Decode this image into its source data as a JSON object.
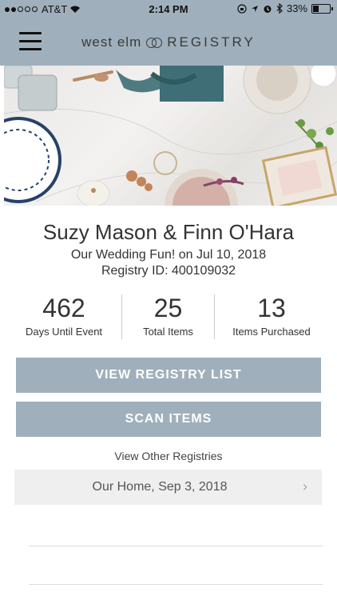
{
  "status": {
    "carrier": "AT&T",
    "time": "2:14 PM",
    "battery": "33%",
    "battery_level": 0.33
  },
  "nav": {
    "brand_left": "west elm",
    "brand_right": "REGISTRY",
    "menu_icon": "hamburger-icon"
  },
  "registry": {
    "names": "Suzy Mason & Finn O'Hara",
    "event_line": "Our Wedding Fun! on Jul 10, 2018",
    "registry_id": "Registry ID: 400109032"
  },
  "stats": [
    {
      "value": "462",
      "label": "Days Until Event"
    },
    {
      "value": "25",
      "label": "Total Items"
    },
    {
      "value": "13",
      "label": "Items Purchased"
    }
  ],
  "actions": {
    "view_list": "VIEW REGISTRY LIST",
    "scan_items": "SCAN ITEMS"
  },
  "other_registries": {
    "heading": "View Other Registries",
    "items": [
      {
        "label": "Our Home, Sep 3, 2018"
      }
    ]
  },
  "colors": {
    "accent": "#9fb0bc",
    "row_bg": "#efefef"
  }
}
